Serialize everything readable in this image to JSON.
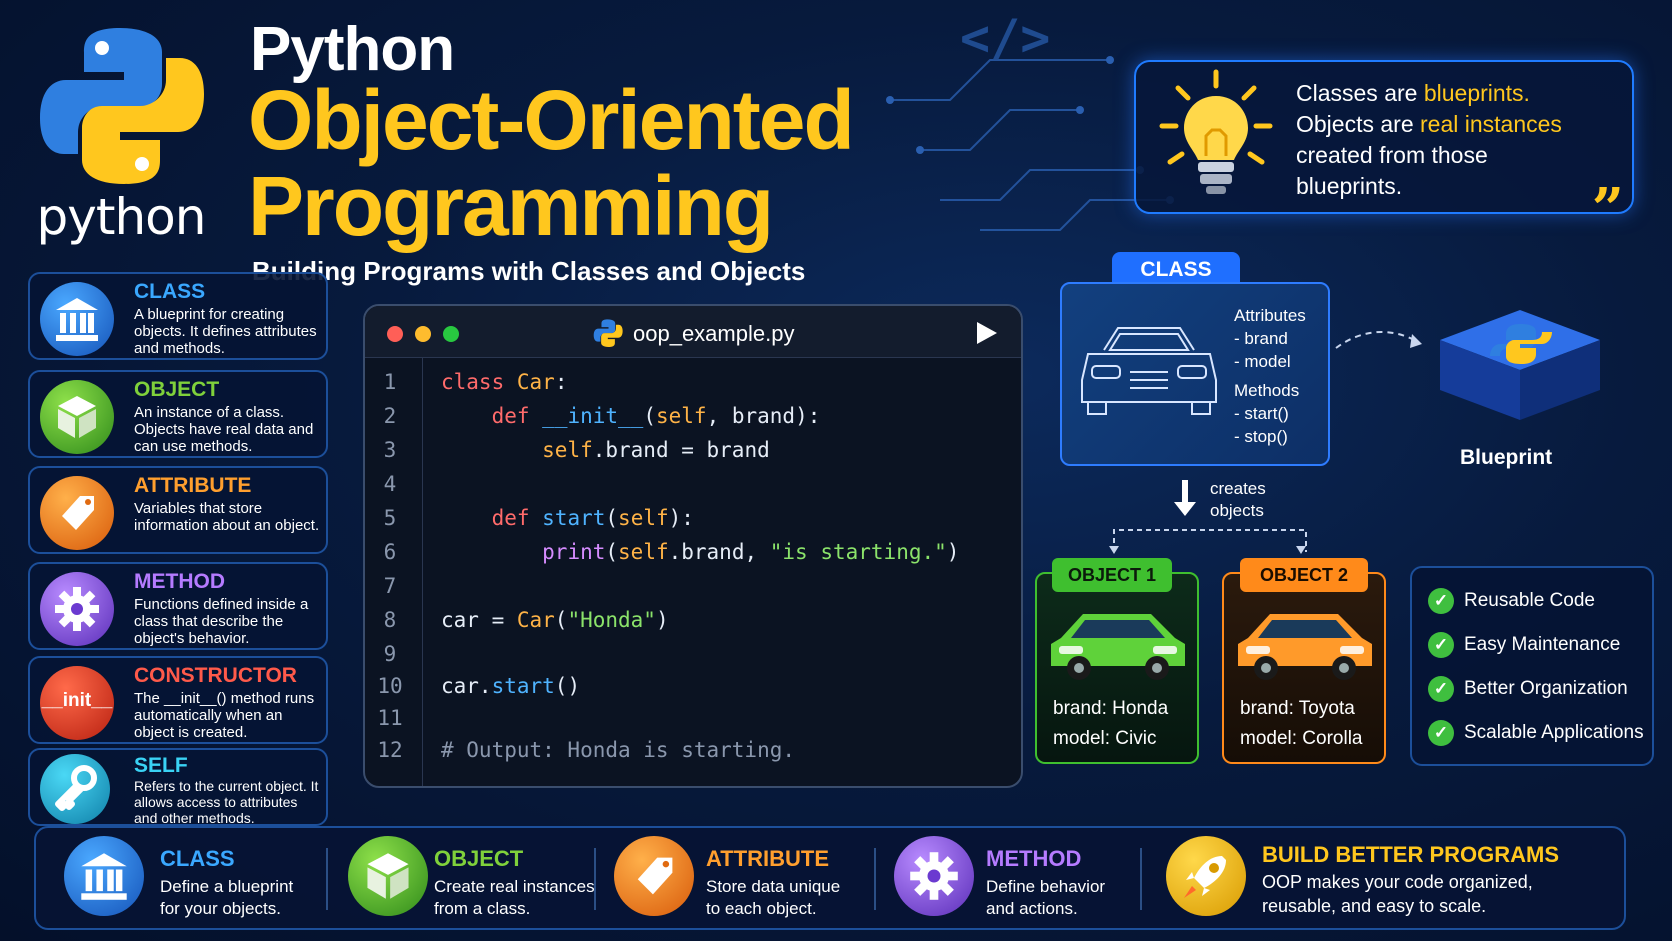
{
  "logo": {
    "text": "python"
  },
  "header": {
    "title_line1": "Python",
    "title_line2": "Object-Oriented",
    "title_line3": "Programming",
    "subtitle": "Building Programs with Classes and Objects"
  },
  "quote": {
    "line1_a": "Classes are ",
    "line1_b": "blueprints.",
    "line2_a": "Objects are ",
    "line2_b": "real instances",
    "line3": "created from those",
    "line4": "blueprints.",
    "mark": "”"
  },
  "concepts": [
    {
      "name": "CLASS",
      "desc": "A blueprint for creating objects. It defines attributes and methods.",
      "color": "#3aa8ff"
    },
    {
      "name": "OBJECT",
      "desc": "An instance of a class. Objects have real data and can use methods.",
      "color": "#7fd13b"
    },
    {
      "name": "ATTRIBUTE",
      "desc": "Variables that store information about an object.",
      "color": "#ff9f2e"
    },
    {
      "name": "METHOD",
      "desc": "Functions defined inside a class that describe the object's behavior.",
      "color": "#b57bff"
    },
    {
      "name": "CONSTRUCTOR",
      "desc": "The __init__() method runs automatically when an object is created.",
      "color": "#ff5a4a"
    },
    {
      "name": "SELF",
      "desc": "Refers to the current object. It allows access to attributes and other methods.",
      "color": "#3ad3f5"
    }
  ],
  "constructor_icon_text": "__init__",
  "code": {
    "filename": "oop_example.py",
    "line_numbers": [
      "1",
      "2",
      "3",
      "4",
      "5",
      "6",
      "7",
      "8",
      "9",
      "10",
      "11",
      "12"
    ],
    "l1_kw": "class",
    "l1_cls": "Car",
    "l1_rest": ":",
    "l2_kw": "def",
    "l2_fn": "__init__",
    "l2_open": "(",
    "l2_self": "self",
    "l2_rest": ", brand):",
    "l3_self": "self",
    "l3_rest": ".brand = brand",
    "l5_kw": "def",
    "l5_fn": "start",
    "l5_open": "(",
    "l5_self": "self",
    "l5_rest": "):",
    "l6_pr": "print",
    "l6_open": "(",
    "l6_self": "self",
    "l6_mid": ".brand, ",
    "l6_str": "\"is starting.\"",
    "l6_close": ")",
    "l8_a": "car = ",
    "l8_cls": "Car",
    "l8_open": "(",
    "l8_str": "\"Honda\"",
    "l8_close": ")",
    "l10_a": "car.",
    "l10_fn": "start",
    "l10_b": "()",
    "l12_cm": "# Output: Honda is starting."
  },
  "class_diagram": {
    "tab": "CLASS",
    "attributes_label": "Attributes",
    "attr1": "- brand",
    "attr2": "- model",
    "methods_label": "Methods",
    "method1": "- start()",
    "method2": "- stop()",
    "blueprint_label": "Blueprint",
    "creates_line1": "creates",
    "creates_line2": "objects"
  },
  "objects": [
    {
      "tab": "OBJECT 1",
      "brand": "brand: Honda",
      "model": "model: Civic",
      "color": "#3fbf2f"
    },
    {
      "tab": "OBJECT 2",
      "brand": "brand: Toyota",
      "model": "model: Corolla",
      "color": "#ff8a1a"
    }
  ],
  "benefits": [
    "Reusable Code",
    "Easy Maintenance",
    "Better Organization",
    "Scalable Applications"
  ],
  "bottom": [
    {
      "name": "CLASS",
      "line1": "Define a blueprint",
      "line2": "for your objects.",
      "color": "#3aa8ff"
    },
    {
      "name": "OBJECT",
      "line1": "Create real instances",
      "line2": "from a class.",
      "color": "#7fd13b"
    },
    {
      "name": "ATTRIBUTE",
      "line1": "Store data unique",
      "line2": "to each object.",
      "color": "#ff9f2e"
    },
    {
      "name": "METHOD",
      "line1": "Define behavior",
      "line2": "and actions.",
      "color": "#b57bff"
    },
    {
      "name": "BUILD BETTER PROGRAMS",
      "line1": "OOP makes your code organized,",
      "line2": "reusable, and easy to scale.",
      "color": "#ffc71e"
    }
  ]
}
